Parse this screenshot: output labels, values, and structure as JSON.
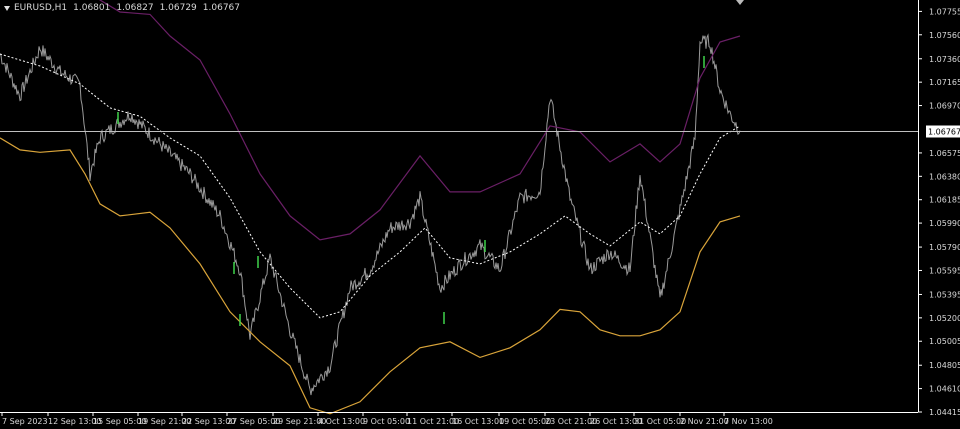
{
  "header": {
    "symbol_timeframe": "EURUSD,H1",
    "open": "1.06801",
    "high": "1.06827",
    "low": "1.06729",
    "close": "1.06767"
  },
  "price_axis": {
    "labels": [
      "1.07755",
      "1.07560",
      "1.07360",
      "1.07165",
      "1.06970",
      "1.06575",
      "1.06380",
      "1.06185",
      "1.05990",
      "1.05790",
      "1.05595",
      "1.05395",
      "1.05200",
      "1.05005",
      "1.04805",
      "1.04610",
      "1.04415"
    ],
    "current_price": "1.06767"
  },
  "time_axis": {
    "labels": [
      "7 Sep 2023",
      "12 Sep 13:00",
      "15 Sep 05:00",
      "19 Sep 21:00",
      "22 Sep 13:00",
      "27 Sep 05:00",
      "29 Sep 21:00",
      "4 Oct 13:00",
      "9 Oct 05:00",
      "11 Oct 21:00",
      "16 Oct 13:00",
      "19 Oct 05:00",
      "23 Oct 21:00",
      "26 Oct 13:00",
      "31 Oct 05:00",
      "2 Nov 21:00",
      "7 Nov 13:00"
    ]
  },
  "colors": {
    "background": "#000000",
    "price_line": "#9a9a9a",
    "upper_band": "#6a1f66",
    "lower_band": "#d9a43a",
    "middle_band": "#ffffff",
    "axis": "#ffffff",
    "text": "#d8d8d8",
    "highlight": "#3fd24a"
  },
  "chart_data": {
    "type": "line",
    "title": "EURUSD,H1",
    "ylim": [
      1.04415,
      1.0785
    ],
    "series": [
      {
        "name": "",
        "role": "price",
        "x_index": [
          0,
          20,
          40,
          60,
          80,
          90,
          100,
          130,
          160,
          190,
          220,
          240,
          250,
          270,
          290,
          310,
          330,
          350,
          370,
          390,
          410,
          420,
          440,
          460,
          480,
          500,
          520,
          540,
          550,
          570,
          590,
          610,
          630,
          640,
          660,
          680,
          695,
          700,
          710,
          720,
          730,
          740
        ],
        "values": [
          1.074,
          1.0705,
          1.0745,
          1.0725,
          1.0715,
          1.064,
          1.067,
          1.069,
          1.0665,
          1.064,
          1.0605,
          1.056,
          1.0505,
          1.057,
          1.051,
          1.046,
          1.048,
          1.0545,
          1.056,
          1.0595,
          1.06,
          1.062,
          1.0545,
          1.0565,
          1.058,
          1.056,
          1.062,
          1.0625,
          1.0705,
          1.062,
          1.056,
          1.0575,
          1.056,
          1.064,
          1.0535,
          1.061,
          1.067,
          1.075,
          1.075,
          1.071,
          1.069,
          1.0676
        ]
      },
      {
        "name": "",
        "role": "upper_band",
        "x_index": [
          80,
          100,
          120,
          150,
          170,
          200,
          230,
          260,
          290,
          320,
          350,
          380,
          420,
          450,
          480,
          520,
          550,
          580,
          610,
          640,
          660,
          680,
          700,
          720,
          740
        ],
        "values": [
          1.08,
          1.0785,
          1.0775,
          1.0773,
          1.0755,
          1.0735,
          1.069,
          1.064,
          1.0605,
          1.0585,
          1.059,
          1.061,
          1.0655,
          1.0625,
          1.0625,
          1.064,
          1.068,
          1.0675,
          1.065,
          1.0665,
          1.065,
          1.0665,
          1.072,
          1.075,
          1.0755
        ]
      },
      {
        "name": "",
        "role": "middle_band",
        "x_index": [
          0,
          40,
          80,
          110,
          140,
          170,
          200,
          230,
          260,
          290,
          320,
          340,
          370,
          400,
          425,
          450,
          480,
          510,
          540,
          565,
          590,
          610,
          640,
          660,
          680,
          700,
          720,
          740
        ],
        "values": [
          1.074,
          1.073,
          1.0715,
          1.0695,
          1.0688,
          1.067,
          1.0655,
          1.062,
          1.0575,
          1.0545,
          1.052,
          1.0525,
          1.0555,
          1.0575,
          1.0595,
          1.057,
          1.0565,
          1.0575,
          1.059,
          1.0605,
          1.059,
          1.058,
          1.06,
          1.059,
          1.0605,
          1.064,
          1.067,
          1.068
        ]
      },
      {
        "name": "",
        "role": "lower_band",
        "x_index": [
          0,
          20,
          40,
          70,
          85,
          100,
          120,
          150,
          170,
          200,
          230,
          260,
          290,
          310,
          330,
          360,
          390,
          420,
          450,
          480,
          510,
          540,
          560,
          580,
          600,
          620,
          640,
          660,
          680,
          700,
          720,
          740
        ],
        "values": [
          1.067,
          1.066,
          1.0658,
          1.066,
          1.064,
          1.0615,
          1.0605,
          1.0608,
          1.0595,
          1.0565,
          1.0525,
          1.05,
          1.048,
          1.0445,
          1.044,
          1.045,
          1.0475,
          1.0495,
          1.05,
          1.0487,
          1.0495,
          1.051,
          1.0527,
          1.0525,
          1.051,
          1.0505,
          1.0505,
          1.051,
          1.0525,
          1.0575,
          1.06,
          1.0605
        ]
      }
    ]
  }
}
